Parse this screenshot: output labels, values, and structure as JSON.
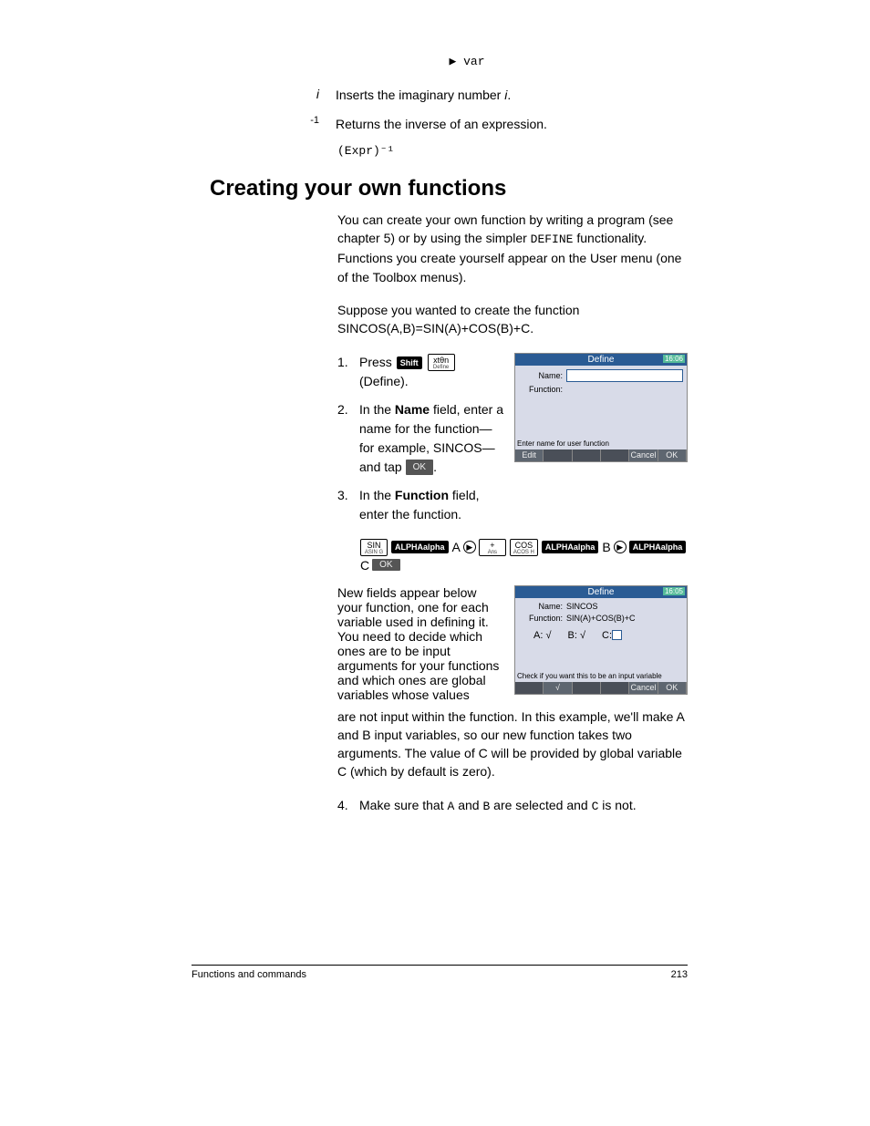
{
  "intro": {
    "arrow_var": "▶ var",
    "i_label": "i",
    "i_text_a": "Inserts the imaginary number ",
    "i_text_b": "i",
    "i_text_c": ".",
    "inv_label": "-1",
    "inv_text": "Returns the inverse of an expression.",
    "inv_code": "(Expr)⁻¹"
  },
  "heading": "Creating your own functions",
  "p1_a": "You can create your own function by writing a program (see chapter 5) or by using the simpler ",
  "p1_code": "DEFINE",
  "p1_b": " functionality. Functions you create yourself appear on the User menu (one of the Toolbox menus).",
  "p2": "Suppose you wanted to create the function SINCOS(A,B)=SIN(A)+COS(B)+C.",
  "step1": {
    "a": "Press ",
    "key1": "Shift",
    "key2": "xtθn",
    "key2_sub": "Define",
    "b": " (Define)."
  },
  "step2": {
    "a": "In the ",
    "b": "Name",
    "c": " field, enter a name for the function—for example, SINCOS—and tap ",
    "ok": "OK",
    "d": "."
  },
  "step3": {
    "a": "In the ",
    "b": "Function",
    "c": " field, enter the function."
  },
  "keyseq": {
    "sin": "SIN",
    "sin_sub": "ASIN G",
    "alpha": "ALPHA",
    "alpha_sub": "alpha",
    "A": "A",
    "plus": "+",
    "plus_sub": "Ans",
    "cos": "COS",
    "cos_sub": "ACOS H",
    "B": "B",
    "C": "C",
    "ok": "OK"
  },
  "step_new_fields": "New fields appear below your function, one for each variable used in defining it. You need to decide which ones are to be input arguments for your functions and which ones are global variables whose values",
  "step_new_fields_cont": "are not input within the function. In this example, we'll make A and B input variables, so our new function takes two arguments. The value of C will be provided by global variable C (which by default is zero).",
  "step4": {
    "a": "Make sure that ",
    "A": "A",
    "b": " and ",
    "B": "B",
    "c": " are selected and ",
    "C": "C",
    "d": " is not."
  },
  "calc1": {
    "title": "Define",
    "time": "16:06",
    "name_label": "Name:",
    "func_label": "Function:",
    "hint": "Enter name for user function",
    "edit": "Edit",
    "cancel": "Cancel",
    "ok": "OK"
  },
  "calc2": {
    "title": "Define",
    "time": "16:05",
    "name_label": "Name:",
    "name_val": "SINCOS",
    "func_label": "Function:",
    "func_val": "SIN(A)+COS(B)+C",
    "A": "A: √",
    "B": "B: √",
    "C": "C:",
    "hint": "Check if you want this to be an input variable",
    "check": "√",
    "cancel": "Cancel",
    "ok": "OK"
  },
  "footer": {
    "left": "Functions and commands",
    "right": "213"
  }
}
